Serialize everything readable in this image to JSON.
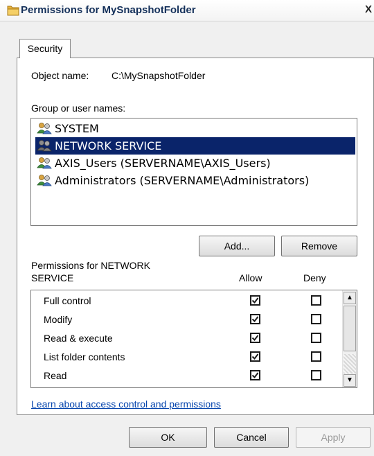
{
  "window": {
    "title": "Permissions for MySnapshotFolder",
    "close_label": "X"
  },
  "tabs": [
    {
      "label": "Security",
      "selected": true
    }
  ],
  "object": {
    "label": "Object name:",
    "value": "C:\\MySnapshotFolder"
  },
  "group_users": {
    "label": "Group or user names:",
    "items": [
      {
        "name": "SYSTEM",
        "selected": false,
        "icon": "users-group-icon"
      },
      {
        "name": "NETWORK SERVICE",
        "selected": true,
        "icon": "users-group-icon"
      },
      {
        "name": "AXIS_Users (SERVERNAME\\AXIS_Users)",
        "selected": false,
        "icon": "users-group-icon"
      },
      {
        "name": "Administrators (SERVERNAME\\Administrators)",
        "selected": false,
        "icon": "users-group-icon"
      }
    ]
  },
  "buttons": {
    "add": "Add...",
    "remove": "Remove",
    "ok": "OK",
    "cancel": "Cancel",
    "apply": "Apply"
  },
  "permissions": {
    "label_line1": "Permissions for NETWORK",
    "label_line2": "SERVICE",
    "allow_header": "Allow",
    "deny_header": "Deny",
    "rows": [
      {
        "name": "Full control",
        "allow": true,
        "deny": false
      },
      {
        "name": "Modify",
        "allow": true,
        "deny": false
      },
      {
        "name": "Read & execute",
        "allow": true,
        "deny": false
      },
      {
        "name": "List folder contents",
        "allow": true,
        "deny": false
      },
      {
        "name": "Read",
        "allow": true,
        "deny": false
      }
    ]
  },
  "link": "Learn about access control and permissions",
  "colors": {
    "selection": "#0a246a",
    "link": "#0645ad",
    "title": "#14305a"
  }
}
